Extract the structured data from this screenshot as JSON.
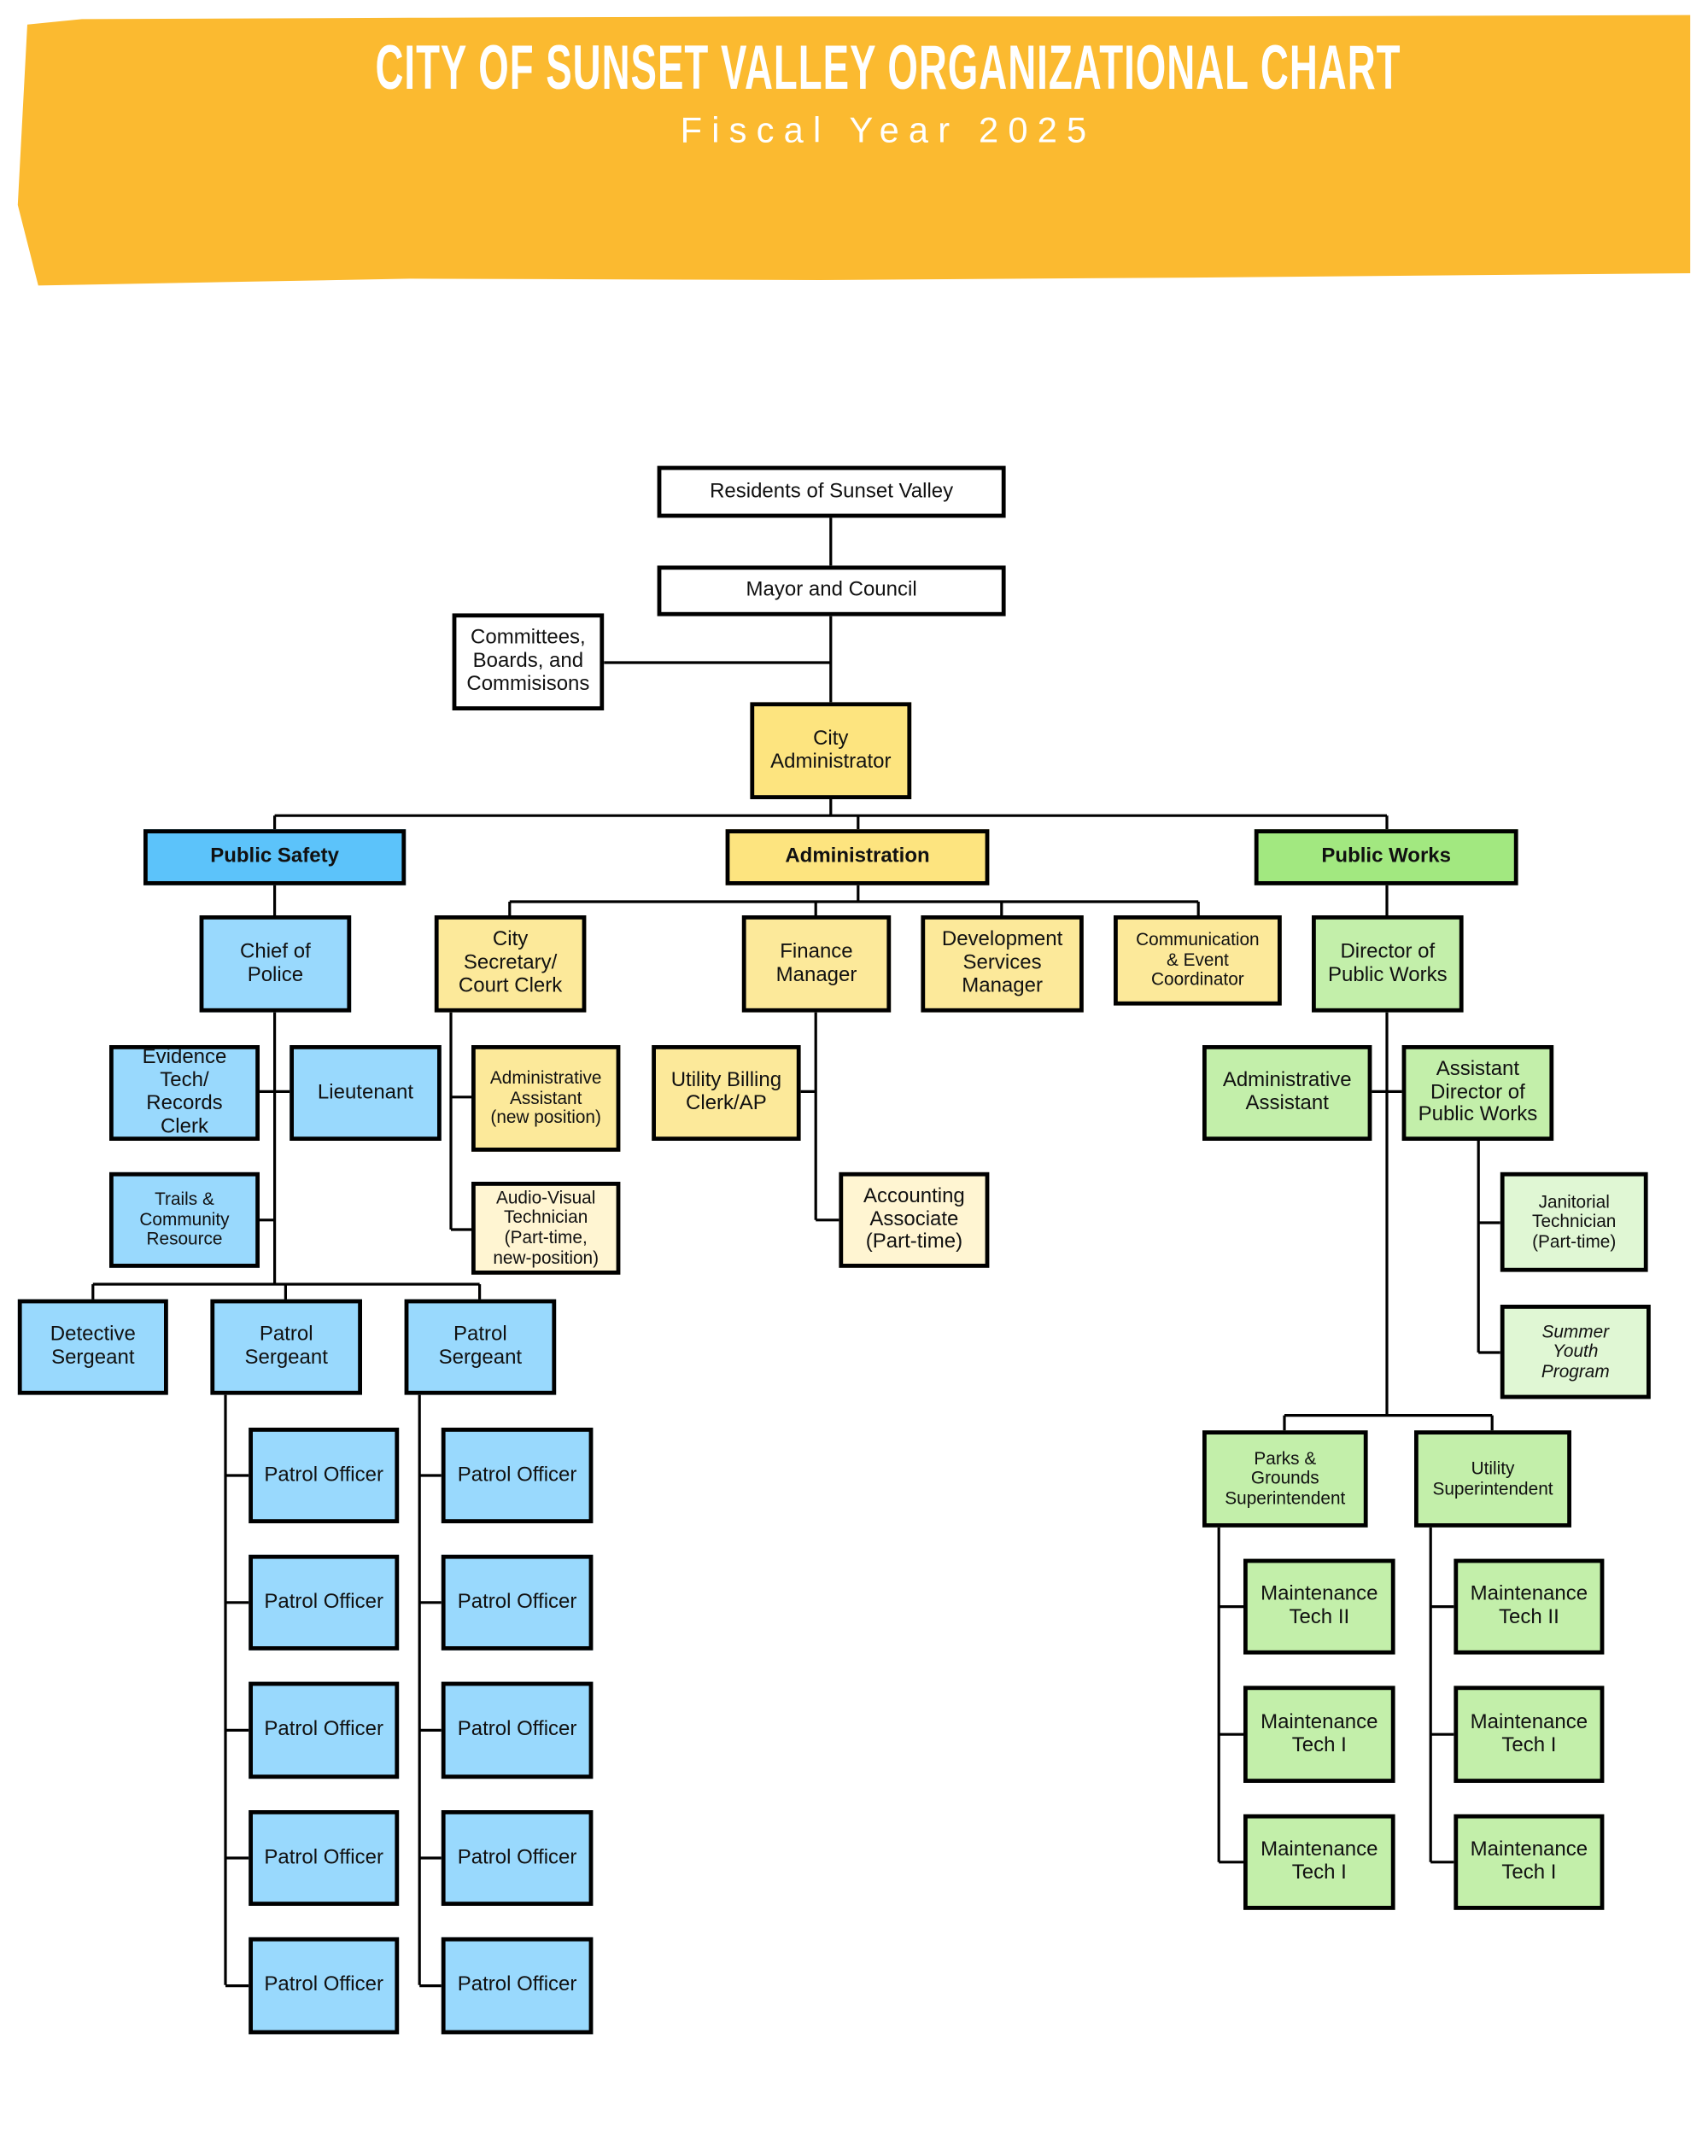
{
  "header": {
    "title": "CITY OF SUNSET VALLEY ORGANIZATIONAL CHART",
    "subtitle": "Fiscal Year 2025",
    "banner_color": "#FBBA30"
  },
  "colors": {
    "white": "#FFFFFF",
    "ps_header": "#5CC3FA",
    "ps_box": "#99D9FD",
    "admin_header": "#FDE47F",
    "admin_box": "#FCE99A",
    "admin_light": "#FFF5D2",
    "pw_header": "#A2E880",
    "pw_box": "#C3EFAA",
    "pw_light": "#E0F7D4"
  },
  "nodes": {
    "residents": "Residents of Sunset Valley",
    "mayor": "Mayor and Council",
    "committees": "Committees,\nBoards, and\nCommisisons",
    "city_admin": "City\nAdministrator",
    "public_safety": "Public Safety",
    "administration": "Administration",
    "public_works": "Public Works",
    "chief": "Chief of\nPolice",
    "city_secretary": "City\nSecretary/\nCourt Clerk",
    "finance": "Finance\nManager",
    "dev_services": "Development\nServices\nManager",
    "communication": "Communication\n& Event\nCoordinator",
    "director_pw": "Director of\nPublic Works",
    "evidence": "Evidence\nTech/\nRecords\nClerk",
    "lieutenant": "Lieutenant",
    "admin_assistant_new": "Administrative\nAssistant\n(new position)",
    "av_tech": "Audio-Visual\nTechnician\n(Part-time,\nnew-position)",
    "utility_billing": "Utility Billing\nClerk/AP",
    "accounting": "Accounting\nAssociate\n(Part-time)",
    "trails": "Trails &\nCommunity\nResource",
    "admin_assistant_pw": "Administrative\nAssistant",
    "asst_director": "Assistant\nDirector of\nPublic Works",
    "janitorial": "Janitorial\nTechnician\n(Part-time)",
    "summer_youth": "Summer\nYouth\nProgram",
    "detective": "Detective\nSergeant",
    "patrol_sgt_1": "Patrol\nSergeant",
    "patrol_sgt_2": "Patrol\nSergeant",
    "patrol_officers_1": [
      "Patrol Officer",
      "Patrol Officer",
      "Patrol Officer",
      "Patrol Officer",
      "Patrol Officer"
    ],
    "patrol_officers_2": [
      "Patrol Officer",
      "Patrol Officer",
      "Patrol Officer",
      "Patrol Officer",
      "Patrol Officer"
    ],
    "parks": "Parks &\nGrounds\nSuperintendent",
    "utility_sup": "Utility\nSuperintendent",
    "maint_parks": [
      "Maintenance\nTech II",
      "Maintenance\nTech I",
      "Maintenance\nTech I"
    ],
    "maint_utility": [
      "Maintenance\nTech II",
      "Maintenance\nTech I",
      "Maintenance\nTech I"
    ]
  }
}
